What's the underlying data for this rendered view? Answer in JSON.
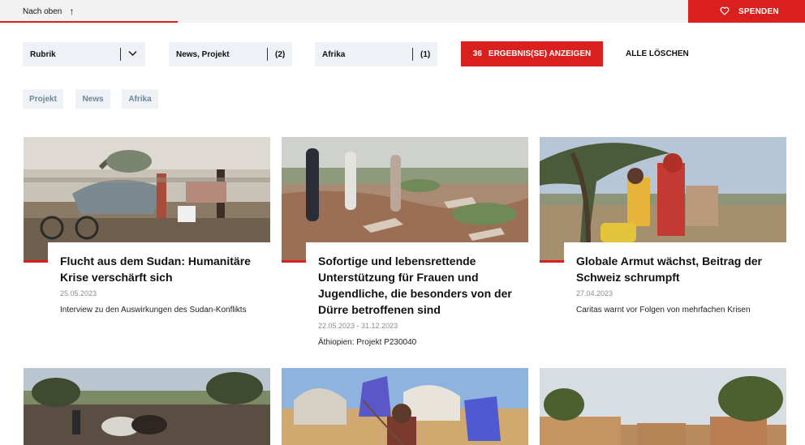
{
  "topbar": {
    "back_label": "Nach oben",
    "donate_label": "SPENDEN"
  },
  "filters": [
    {
      "name": "Rubrik",
      "count": ""
    },
    {
      "name": "News, Projekt",
      "count": "(2)"
    },
    {
      "name": "Afrika",
      "count": "(1)"
    }
  ],
  "results_button": {
    "count": "36",
    "label": "ERGEBNIS(SE) ANZEIGEN"
  },
  "clear_label": "ALLE LÖSCHEN",
  "tags": [
    "Projekt",
    "News",
    "Afrika"
  ],
  "cards": [
    {
      "title": "Flucht aus dem Sudan: Humanitäre Krise verschärft sich",
      "date": "25.05.2023",
      "description": "Interview zu den Auswirkungen des Sudan-Konflikts"
    },
    {
      "title": "Sofortige und lebensrettende Unterstützung für Frauen und Jugendliche, die besonders von der Dürre betroffenen sind",
      "date": "22.05.2023  -  31.12.2023",
      "description": "Äthiopien: Projekt P230040"
    },
    {
      "title": "Globale Armut wächst, Beitrag der Schweiz schrumpft",
      "date": "27.04.2023",
      "description": "Caritas warnt vor Folgen von mehrfachen Krisen"
    }
  ],
  "colors": {
    "accent": "#d9201f",
    "filter_bg": "#eef1f5",
    "tag_text": "#6b8896"
  }
}
